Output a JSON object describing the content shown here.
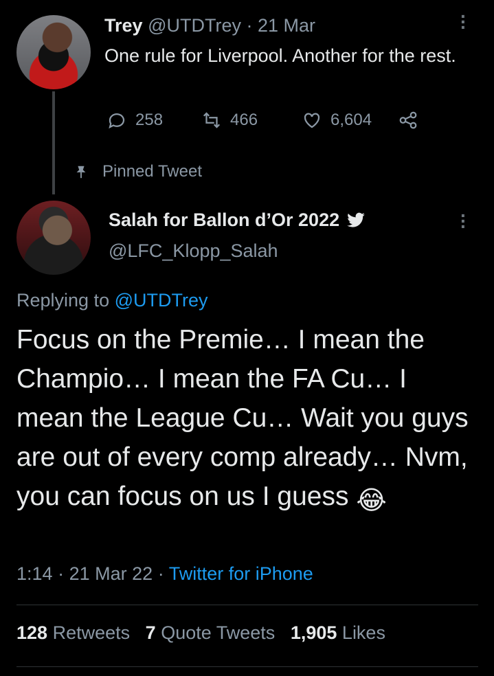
{
  "parent_tweet": {
    "display_name": "Trey",
    "handle": "@UTDTrey",
    "separator": "·",
    "date": "21 Mar",
    "text": "One rule for Liverpool. Another for the rest.",
    "reply_count": "258",
    "retweet_count": "466",
    "like_count": "6,604"
  },
  "pinned_label": "Pinned Tweet",
  "main_tweet": {
    "display_name": "Salah for Ballon d’Or 2022",
    "handle": "@LFC_Klopp_Salah",
    "replying_prefix": "Replying to",
    "replying_handle": "@UTDTrey",
    "text": "Focus on the Premie… I mean the Champio… I mean the FA Cu… I mean the League Cu… Wait you guys are out of every comp already… Nvm, you can focus on us I guess",
    "emoji": "😂",
    "time": "1:14",
    "date": "21 Mar 22",
    "separator": "·",
    "source": "Twitter for iPhone"
  },
  "stats": {
    "retweets_count": "128",
    "retweets_label": "Retweets",
    "quotes_count": "7",
    "quotes_label": "Quote Tweets",
    "likes_count": "1,905",
    "likes_label": "Likes"
  },
  "colors": {
    "background": "#000000",
    "text": "#e7e9ea",
    "muted": "#8b98a5",
    "link": "#1d9bf0"
  }
}
